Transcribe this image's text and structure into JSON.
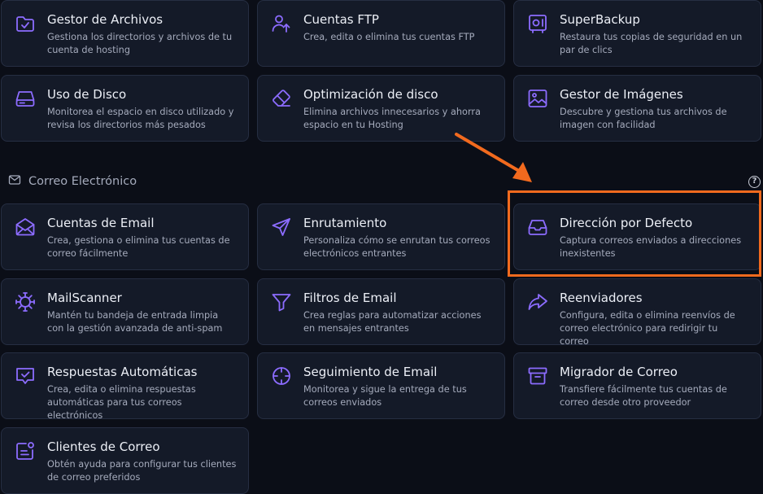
{
  "colors": {
    "background": "#0b0e17",
    "card": "#141a28",
    "accent": "#8c6cff",
    "annotation": "#f26a1e"
  },
  "cards_top": [
    {
      "title": "Gestor de Archivos",
      "desc": "Gestiona los directorios y archivos de tu cuenta de hosting",
      "icon": "folder-check-icon"
    },
    {
      "title": "Cuentas FTP",
      "desc": "Crea, edita o elimina tus cuentas FTP",
      "icon": "user-upload-icon"
    },
    {
      "title": "SuperBackup",
      "desc": "Restaura tus copias de seguridad en un par de clics",
      "icon": "backup-icon"
    },
    {
      "title": "Uso de Disco",
      "desc": "Monitorea el espacio en disco utilizado y revisa los directorios más pesados",
      "icon": "disk-icon"
    },
    {
      "title": "Optimización de disco",
      "desc": "Elimina archivos innecesarios y ahorra espacio en tu Hosting",
      "icon": "eraser-icon"
    },
    {
      "title": "Gestor de Imágenes",
      "desc": "Descubre y gestiona tus archivos de imagen con facilidad",
      "icon": "image-icon"
    }
  ],
  "section": {
    "title": "Correo Electrónico",
    "help": "?"
  },
  "cards_email": [
    {
      "title": "Cuentas de Email",
      "desc": "Crea, gestiona o elimina tus cuentas de correo fácilmente",
      "icon": "envelope-icon"
    },
    {
      "title": "Enrutamiento",
      "desc": "Personaliza cómo se enrutan tus correos electrónicos entrantes",
      "icon": "send-icon"
    },
    {
      "title": "Dirección por Defecto",
      "desc": "Captura correos enviados a direcciones inexistentes",
      "icon": "inbox-tray-icon"
    },
    {
      "title": "MailScanner",
      "desc": "Mantén tu bandeja de entrada limpia con la gestión avanzada de anti-spam",
      "icon": "virus-icon"
    },
    {
      "title": "Filtros de Email",
      "desc": "Crea reglas para automatizar acciones en mensajes entrantes",
      "icon": "filter-icon"
    },
    {
      "title": "Reenviadores",
      "desc": "Configura, edita o elimina reenvíos de correo electrónico para redirigir tu correo",
      "icon": "forward-arrow-icon"
    },
    {
      "title": "Respuestas Automáticas",
      "desc": "Crea, edita o elimina respuestas automáticas para tus correos electrónicos",
      "icon": "chat-check-icon"
    },
    {
      "title": "Seguimiento de Email",
      "desc": "Monitorea y sigue la entrega de tus correos enviados",
      "icon": "crosshair-icon"
    },
    {
      "title": "Migrador de Correo",
      "desc": "Transfiere fácilmente tus cuentas de correo desde otro proveedor",
      "icon": "archive-box-icon"
    },
    {
      "title": "Clientes de Correo",
      "desc": "Obtén ayuda para configurar tus clientes de correo preferidos",
      "icon": "mail-client-icon"
    }
  ]
}
